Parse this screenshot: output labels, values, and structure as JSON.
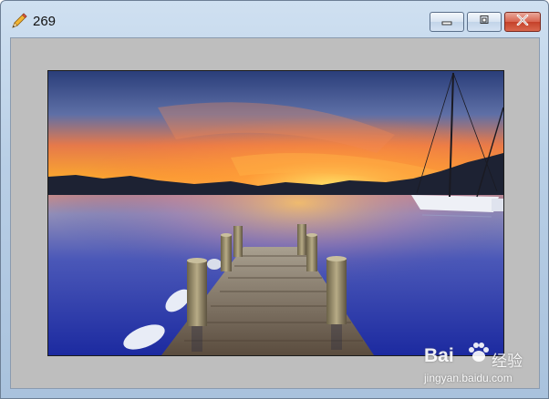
{
  "window": {
    "title": "269",
    "app_icon": "pencil-icon",
    "controls": {
      "minimize_icon": "minimize-icon",
      "maximize_icon": "maximize-icon",
      "close_icon": "close-icon"
    }
  },
  "image": {
    "subject_icon": "lake-pier-sunset-photo"
  },
  "watermark": {
    "brand_part1": "Bai",
    "brand_part2": "经验",
    "url": "jingyan.baidu.com"
  },
  "colors": {
    "client_background": "#bebebe",
    "close_button": "#c4412a",
    "titlebar": "#b9cfe6"
  }
}
